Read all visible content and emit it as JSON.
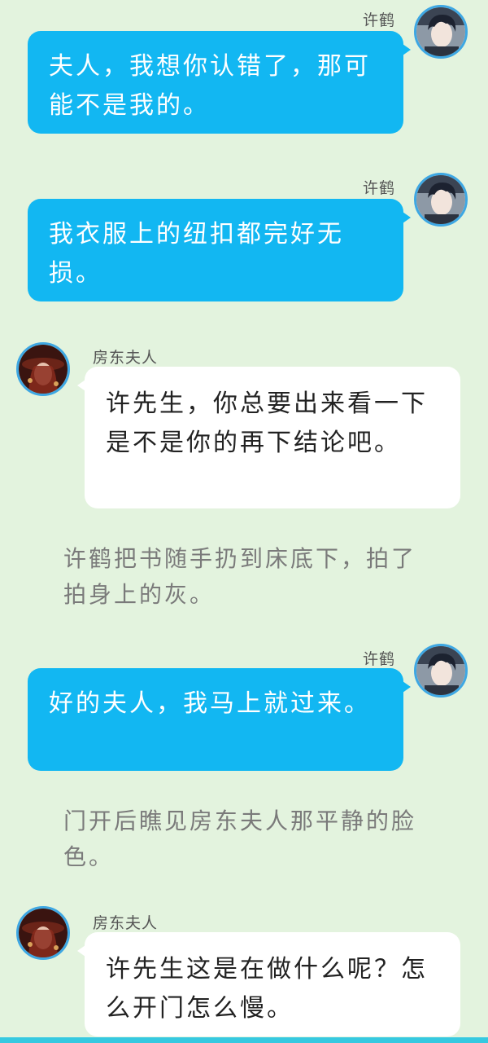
{
  "colors": {
    "background": "#e3f3de",
    "right_bubble": "#12b7f2",
    "left_bubble": "#ffffff",
    "avatar_ring": "#3ea7e3",
    "bottom_bar": "#36c9e0"
  },
  "messages": [
    {
      "type": "right",
      "sender": "许鹤",
      "avatar": "male-avatar",
      "text": "夫人，我想你认错了，那可能不是我的。"
    },
    {
      "type": "right",
      "sender": "许鹤",
      "avatar": "male-avatar",
      "text": "我衣服上的纽扣都完好无损。"
    },
    {
      "type": "left",
      "sender": "房东夫人",
      "avatar": "female-avatar",
      "text": "许先生，你总要出来看一下是不是你的再下结论吧。"
    },
    {
      "type": "narration",
      "text": "许鹤把书随手扔到床底下，拍了拍身上的灰。"
    },
    {
      "type": "right",
      "sender": "许鹤",
      "avatar": "male-avatar",
      "text": "好的夫人，我马上就过来。"
    },
    {
      "type": "narration",
      "text": "门开后瞧见房东夫人那平静的脸色。"
    },
    {
      "type": "left",
      "sender": "房东夫人",
      "avatar": "female-avatar",
      "text": "许先生这是在做什么呢？怎么开门怎么慢。"
    }
  ]
}
